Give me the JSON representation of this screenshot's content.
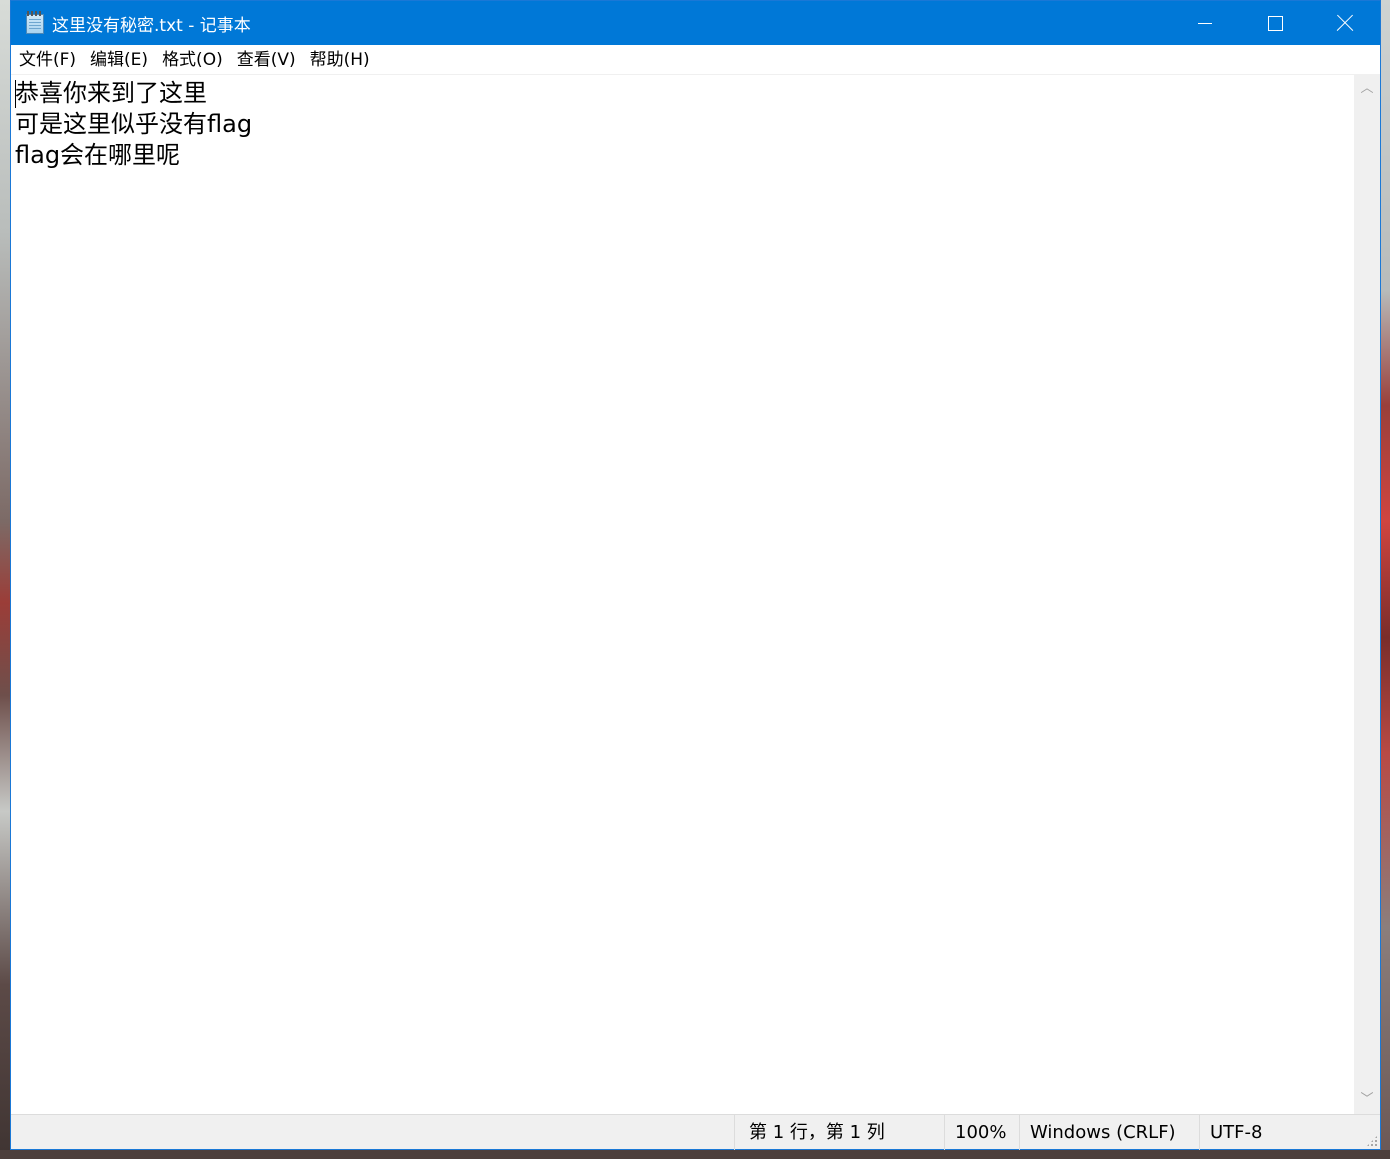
{
  "window": {
    "title": "这里没有秘密.txt - 记事本",
    "accent_color": "#0078d7"
  },
  "controls": {
    "minimize_icon": "minimize-icon",
    "maximize_icon": "maximize-icon",
    "close_icon": "close-icon"
  },
  "menu": {
    "items": [
      {
        "label": "文件(F)"
      },
      {
        "label": "编辑(E)"
      },
      {
        "label": "格式(O)"
      },
      {
        "label": "查看(V)"
      },
      {
        "label": "帮助(H)"
      }
    ]
  },
  "editor": {
    "lines": [
      "恭喜你来到了这里",
      "可是这里似乎没有flag",
      "flag会在哪里呢"
    ]
  },
  "status": {
    "position": "第 1 行，第 1 列",
    "zoom": "100%",
    "line_ending": "Windows (CRLF)",
    "encoding": "UTF-8"
  }
}
